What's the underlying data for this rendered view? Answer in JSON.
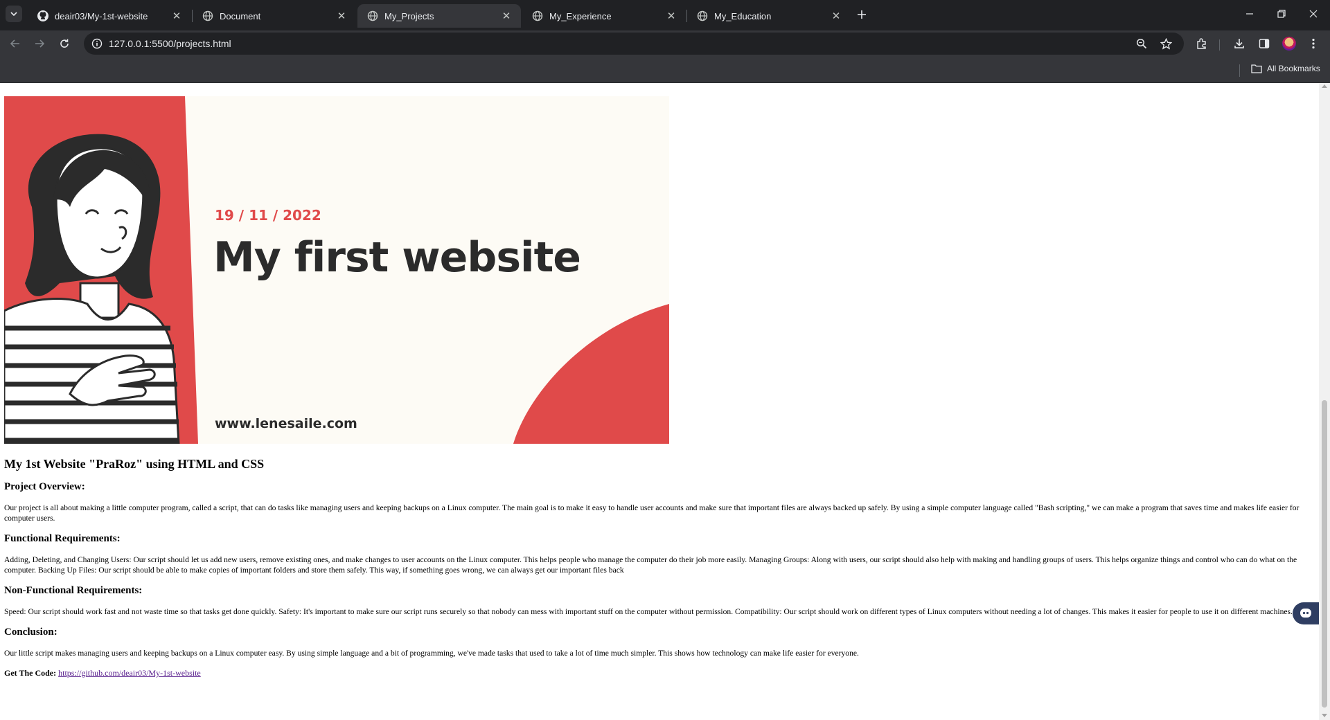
{
  "browser": {
    "tabs": [
      {
        "title": "deair03/My-1st-website",
        "favicon": "github-icon",
        "active": false
      },
      {
        "title": "Document",
        "favicon": "globe-icon",
        "active": false
      },
      {
        "title": "My_Projects",
        "favicon": "globe-icon",
        "active": true
      },
      {
        "title": "My_Experience",
        "favicon": "globe-icon",
        "active": false
      },
      {
        "title": "My_Education",
        "favicon": "globe-icon",
        "active": false
      }
    ],
    "url": "127.0.0.1:5500/projects.html",
    "bookmarks_label": "All Bookmarks"
  },
  "banner": {
    "date": "19 / 11 / 2022",
    "title": "My first website",
    "site": "www.lenesaile.com",
    "accent_color": "#e04a4a",
    "background_color": "#fdfbf5"
  },
  "page": {
    "heading": "My 1st Website \"PraRoz\" using HTML and CSS",
    "sections": [
      {
        "title": "Project Overview:",
        "text": "Our project is all about making a little computer program, called a script, that can do tasks like managing users and keeping backups on a Linux computer. The main goal is to make it easy to handle user accounts and make sure that important files are always backed up safely. By using a simple computer language called \"Bash scripting,\" we can make a program that saves time and makes life easier for computer users."
      },
      {
        "title": "Functional Requirements:",
        "text": "Adding, Deleting, and Changing Users: Our script should let us add new users, remove existing ones, and make changes to user accounts on the Linux computer. This helps people who manage the computer do their job more easily. Managing Groups: Along with users, our script should also help with making and handling groups of users. This helps organize things and control who can do what on the computer. Backing Up Files: Our script should be able to make copies of important folders and store them safely. This way, if something goes wrong, we can always get our important files back"
      },
      {
        "title": "Non-Functional Requirements:",
        "text": "Speed: Our script should work fast and not waste time so that tasks get done quickly. Safety: It's important to make sure our script runs securely so that nobody can mess with important stuff on the computer without permission. Compatibility: Our script should work on different types of Linux computers without needing a lot of changes. This makes it easier for people to use it on different machines."
      },
      {
        "title": "Conclusion:",
        "text": "Our little script makes managing users and keeping backups on a Linux computer easy. By using simple language and a bit of programming, we've made tasks that used to take a lot of time much simpler. This shows how technology can make life easier for everyone."
      }
    ],
    "code_label": "Get The Code:",
    "code_link": "https://github.com/deair03/My-1st-website"
  }
}
